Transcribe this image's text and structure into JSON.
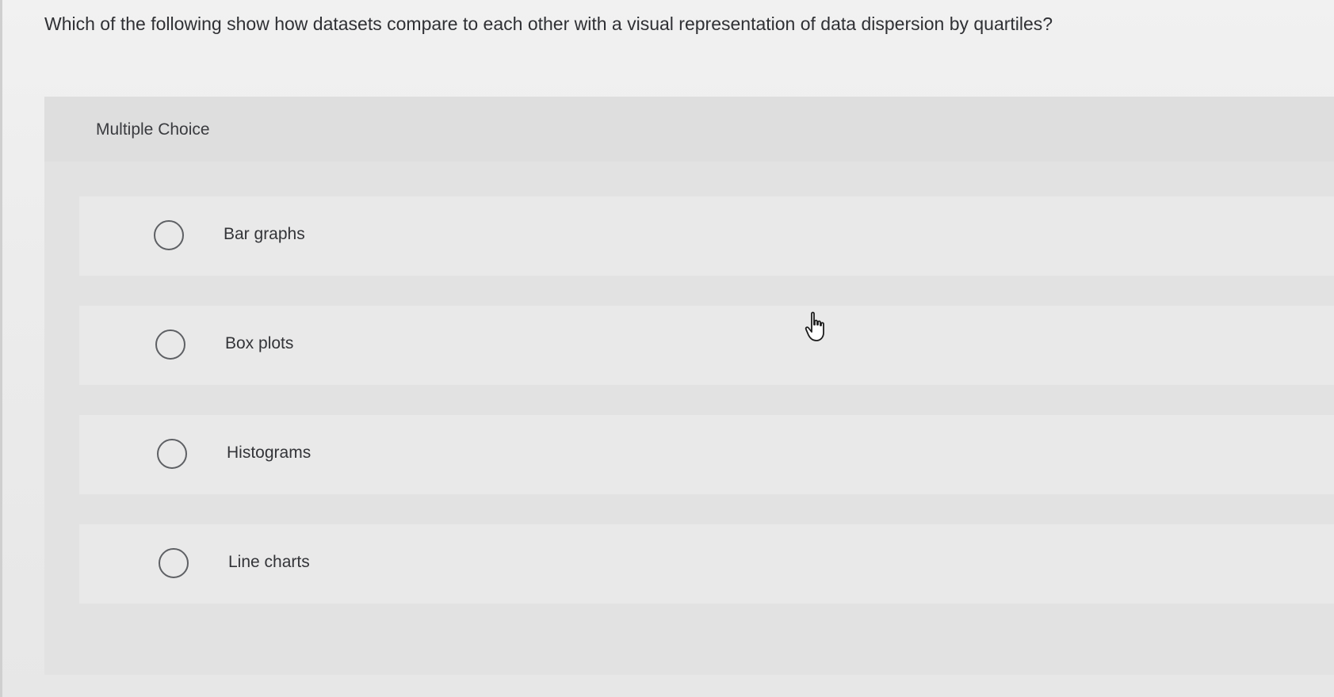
{
  "question": {
    "text": "Which of the following show how datasets compare to each other with a visual representation of data dispersion by quartiles?"
  },
  "panel": {
    "label": "Multiple Choice"
  },
  "choices": [
    {
      "label": "Bar graphs",
      "selected": false
    },
    {
      "label": "Box plots",
      "selected": false
    },
    {
      "label": "Histograms",
      "selected": false
    },
    {
      "label": "Line charts",
      "selected": false
    }
  ],
  "cursor": {
    "icon": "hand-pointer-icon"
  }
}
